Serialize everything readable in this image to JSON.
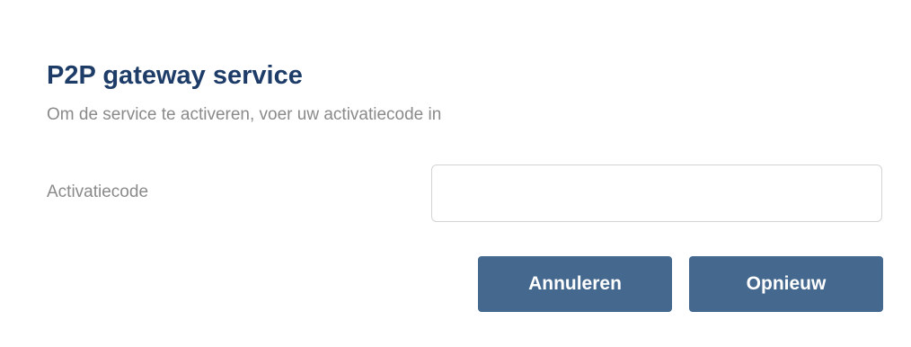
{
  "dialog": {
    "title": "P2P gateway service",
    "subtitle": "Om de service te activeren, voer uw activatiecode in",
    "field": {
      "label": "Activatiecode",
      "value": "",
      "placeholder": ""
    },
    "buttons": {
      "cancel_label": "Annuleren",
      "retry_label": "Opnieuw"
    }
  },
  "colors": {
    "title": "#1e3c68",
    "text_muted": "#8a8a8a",
    "button_bg": "#44688e",
    "button_text": "#ffffff",
    "input_border": "#d4d4d4",
    "background": "#ffffff"
  }
}
